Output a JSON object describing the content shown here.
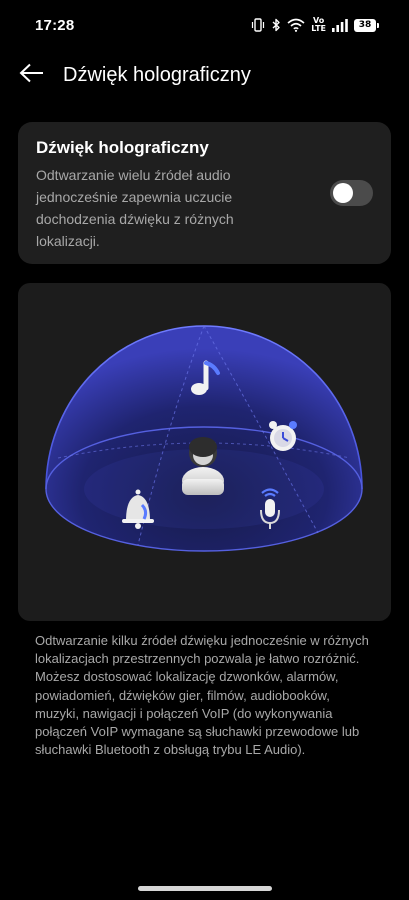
{
  "status_bar": {
    "time": "17:28",
    "volte_top": "Vo",
    "volte_bottom": "LTE",
    "battery": "38",
    "icons": [
      "vibrate-icon",
      "bluetooth-icon",
      "wifi-icon",
      "volte-icon",
      "signal-icon",
      "battery-icon"
    ]
  },
  "header": {
    "back_icon": "arrow-left-icon",
    "title": "Dźwięk holograficzny"
  },
  "setting": {
    "title": "Dźwięk holograficzny",
    "description": "Odtwarzanie wielu źródeł audio jednocześnie zapewnia uczucie dochodzenia dźwięku z różnych lokalizacji.",
    "toggle_on": false
  },
  "illustration": {
    "icons": [
      "person-icon",
      "music-note-icon",
      "alarm-clock-icon",
      "bell-icon",
      "microphone-icon"
    ],
    "colors": {
      "dome": "#2a2f8f",
      "accent": "#5a7bff"
    }
  },
  "footer": {
    "description": "Odtwarzanie kilku źródeł dźwięku jednocześnie w różnych lokalizacjach przestrzennych pozwala je łatwo rozróżnić. Możesz dostosować lokalizację dzwonków, alarmów, powiadomień, dźwięków gier, filmów, audiobooków, muzyki, nawigacji i połączeń VoIP (do wykonywania połączeń VoIP wymagane są słuchawki przewodowe lub słuchawki Bluetooth z obsługą trybu LE Audio)."
  },
  "colors": {
    "background": "#000000",
    "card": "#1f1f1f",
    "text_primary": "#ffffff",
    "text_secondary": "#a8a8a8",
    "toggle_off": "#4b4b4b"
  }
}
